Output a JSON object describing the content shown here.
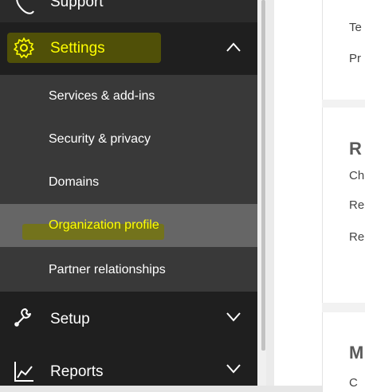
{
  "nav": {
    "top_item": {
      "label": "Support",
      "icon": "support-icon"
    },
    "settings": {
      "label": "Settings",
      "icon": "gear-icon",
      "expanded": true
    },
    "settings_items": [
      {
        "label": "Services & add-ins",
        "active": false
      },
      {
        "label": "Security & privacy",
        "active": false
      },
      {
        "label": "Domains",
        "active": false
      },
      {
        "label": "Organization profile",
        "active": true
      },
      {
        "label": "Partner relationships",
        "active": false
      }
    ],
    "setup": {
      "label": "Setup",
      "icon": "wrench-icon"
    },
    "reports": {
      "label": "Reports",
      "icon": "chart-icon"
    }
  },
  "content": {
    "card1": {
      "line1": "Te",
      "line2": "Pr"
    },
    "card2": {
      "title": "R",
      "line1": "Ch",
      "line2": "Re",
      "line3": "Re"
    },
    "card3": {
      "title": "M",
      "line1": "C"
    }
  },
  "colors": {
    "highlight": "#ffff00",
    "sidebar_dark": "#1f1f1f",
    "submenu": "#393939",
    "active_item": "#666666"
  }
}
